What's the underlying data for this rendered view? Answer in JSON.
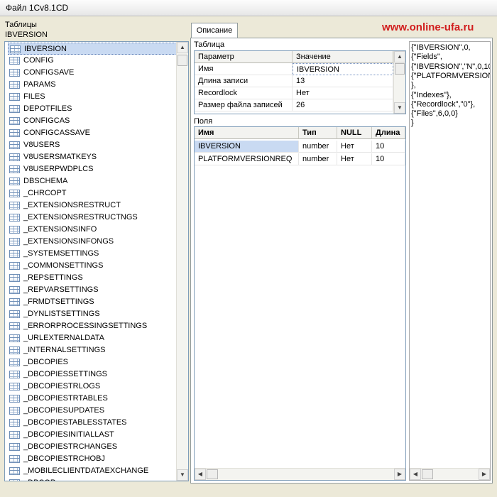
{
  "window": {
    "title": "Файл 1Cv8.1CD"
  },
  "left": {
    "tables_label": "Таблицы",
    "current_table": "IBVERSION",
    "items": [
      "IBVERSION",
      "CONFIG",
      "CONFIGSAVE",
      "PARAMS",
      "FILES",
      "DEPOTFILES",
      "CONFIGCAS",
      "CONFIGCASSAVE",
      "V8USERS",
      "V8USERSMATKEYS",
      "V8USERPWDPLCS",
      "DBSCHEMA",
      "_CHRCOPT",
      "_EXTENSIONSRESTRUCT",
      "_EXTENSIONSRESTRUCTNGS",
      "_EXTENSIONSINFO",
      "_EXTENSIONSINFONGS",
      "_SYSTEMSETTINGS",
      "_COMMONSETTINGS",
      "_REPSETTINGS",
      "_REPVARSETTINGS",
      "_FRMDTSETTINGS",
      "_DYNLISTSETTINGS",
      "_ERRORPROCESSINGSETTINGS",
      "_URLEXTERNALDATA",
      "_INTERNALSETTINGS",
      "_DBCOPIES",
      "_DBCOPIESSETTINGS",
      "_DBCOPIESTRLOGS",
      "_DBCOPIESTRTABLES",
      "_DBCOPIESUPDATES",
      "_DBCOPIESTABLESSTATES",
      "_DBCOPIESINITIALLAST",
      "_DBCOPIESTRCHANGES",
      "_DBCOPIESTRCHOBJ",
      "_MOBILECLIENTDATAEXCHANGE",
      "_DBCOP..."
    ],
    "selected_index": 0
  },
  "tab": {
    "label": "Описание"
  },
  "watermark": "www.online-ufa.ru",
  "table_section": {
    "label": "Таблица",
    "headers": [
      "Параметр",
      "Значение"
    ],
    "rows": [
      [
        "Имя",
        "IBVERSION"
      ],
      [
        "Длина записи",
        "13"
      ],
      [
        "Recordlock",
        "Нет"
      ],
      [
        "Размер файла записей",
        "26"
      ]
    ]
  },
  "fields_section": {
    "label": "Поля",
    "headers": [
      "Имя",
      "Тип",
      "NULL",
      "Длина"
    ],
    "rows": [
      [
        "IBVERSION",
        "number",
        "Нет",
        "10"
      ],
      [
        "PLATFORMVERSIONREQ",
        "number",
        "Нет",
        "10"
      ]
    ]
  },
  "description_lines": [
    "{\"IBVERSION\",0,",
    "{\"Fields\",",
    "{\"IBVERSION\",\"N\",0,10",
    "{\"PLATFORMVERSION",
    "},",
    "{\"Indexes\"},",
    "{\"Recordlock\",\"0\"},",
    "{\"Files\",6,0,0}",
    "}"
  ],
  "colors": {
    "selection": "#c9daf2",
    "watermark": "#d11e1e",
    "window_bg": "#ece9d8"
  },
  "icons": {
    "table": "table-icon",
    "scroll_up": "arrow-up-icon",
    "scroll_down": "arrow-down-icon",
    "scroll_left": "arrow-left-icon",
    "scroll_right": "arrow-right-icon"
  }
}
